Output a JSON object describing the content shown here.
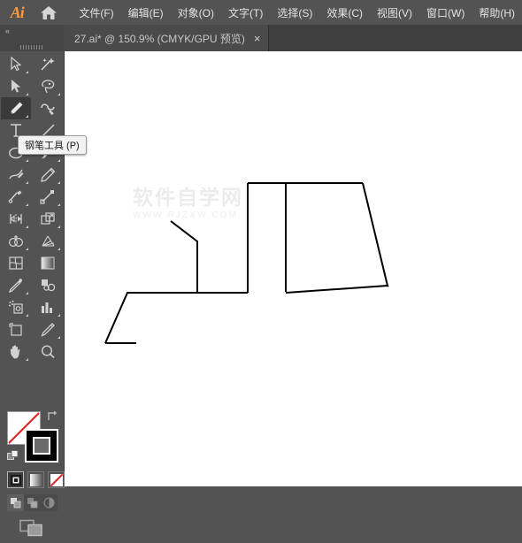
{
  "app": {
    "logo_text": "Ai",
    "home_icon": "home-icon"
  },
  "menubar": {
    "items": [
      {
        "label": "文件(F)",
        "name": "menu-file"
      },
      {
        "label": "编辑(E)",
        "name": "menu-edit"
      },
      {
        "label": "对象(O)",
        "name": "menu-object"
      },
      {
        "label": "文字(T)",
        "name": "menu-type"
      },
      {
        "label": "选择(S)",
        "name": "menu-select"
      },
      {
        "label": "效果(C)",
        "name": "menu-effect"
      },
      {
        "label": "视图(V)",
        "name": "menu-view"
      },
      {
        "label": "窗口(W)",
        "name": "menu-window"
      },
      {
        "label": "帮助(H)",
        "name": "menu-help"
      }
    ]
  },
  "tabbar": {
    "collapse_glyph": "«",
    "tab": {
      "label": "27.ai* @ 150.9% (CMYK/GPU 预览)",
      "close_glyph": "×"
    }
  },
  "tooltip": {
    "text": "钢笔工具 (P)"
  },
  "toolpanel": {
    "tools": [
      {
        "name": "selection-tool",
        "label": "选择工具",
        "active": false
      },
      {
        "name": "magic-wand-tool",
        "label": "魔棒工具",
        "active": false
      },
      {
        "name": "direct-selection-tool",
        "label": "直接选择工具",
        "active": false
      },
      {
        "name": "lasso-tool",
        "label": "套索工具",
        "active": false
      },
      {
        "name": "pen-tool",
        "label": "钢笔工具",
        "active": true
      },
      {
        "name": "curvature-tool",
        "label": "曲率工具",
        "active": false
      },
      {
        "name": "type-tool",
        "label": "文字工具",
        "active": false
      },
      {
        "name": "line-segment-tool",
        "label": "直线段工具",
        "active": false
      },
      {
        "name": "ellipse-tool",
        "label": "椭圆工具",
        "active": false
      },
      {
        "name": "paintbrush-tool",
        "label": "画笔工具",
        "active": false
      },
      {
        "name": "shaper-tool",
        "label": "Shaper工具",
        "active": false
      },
      {
        "name": "pencil-tool",
        "label": "铅笔工具",
        "active": false
      },
      {
        "name": "rotate-tool",
        "label": "旋转工具",
        "active": false
      },
      {
        "name": "scale-tool",
        "label": "比例缩放工具",
        "active": false
      },
      {
        "name": "width-tool",
        "label": "宽度工具",
        "active": false
      },
      {
        "name": "free-transform-tool",
        "label": "自由变换工具",
        "active": false
      },
      {
        "name": "shape-builder-tool",
        "label": "形状生成器工具",
        "active": false
      },
      {
        "name": "perspective-grid-tool",
        "label": "透视网格工具",
        "active": false
      },
      {
        "name": "mesh-tool",
        "label": "网格工具",
        "active": false
      },
      {
        "name": "gradient-tool",
        "label": "渐变工具",
        "active": false
      },
      {
        "name": "eyedropper-tool",
        "label": "吸管工具",
        "active": false
      },
      {
        "name": "blend-tool",
        "label": "混合工具",
        "active": false
      },
      {
        "name": "symbol-sprayer-tool",
        "label": "符号喷枪工具",
        "active": false
      },
      {
        "name": "column-graph-tool",
        "label": "柱形图工具",
        "active": false
      },
      {
        "name": "artboard-tool",
        "label": "画板工具",
        "active": false
      },
      {
        "name": "slice-tool",
        "label": "切片工具",
        "active": false
      },
      {
        "name": "hand-tool",
        "label": "抓手工具",
        "active": false
      },
      {
        "name": "zoom-tool",
        "label": "缩放工具",
        "active": false
      }
    ]
  },
  "colors": {
    "fill": "#ffffff",
    "fill_is_none": true,
    "stroke": "#000000",
    "swap_icon": "swap-fill-stroke-icon",
    "default_icon": "default-fill-stroke-icon",
    "modes": [
      {
        "name": "color-mode-button",
        "label": "颜色",
        "selected": true
      },
      {
        "name": "gradient-mode-button",
        "label": "渐变",
        "selected": false
      },
      {
        "name": "none-mode-button",
        "label": "无",
        "selected": false
      }
    ],
    "draw_modes": [
      {
        "name": "draw-normal-button",
        "label": "正常绘图",
        "selected": true
      },
      {
        "name": "draw-behind-button",
        "label": "背面绘图",
        "selected": false
      },
      {
        "name": "draw-inside-button",
        "label": "内部绘图",
        "selected": false
      }
    ],
    "screen_mode": {
      "name": "change-screen-mode-button",
      "label": "更改屏幕模式"
    }
  },
  "canvas": {
    "watermark_cn": "软件自学网",
    "watermark_en": "WWW.RJZXW.COM",
    "artwork_name": "pen-tool-path-drawing",
    "stroke_color": "#000000",
    "stroke_width": 2,
    "paths": [
      "M 120 192 L 150 215 L 150 273 L 71 273 L 46 330",
      "M 46 330 L 81 330",
      "M 107 273 L 207 273",
      "M 207 273 L 207 149",
      "M 207 149 L 337 149",
      "M 337 149 L 365 265",
      "M 365 265 L 250 273",
      "M 365 265 L 366 266",
      "M 250 149 L 250 272"
    ]
  }
}
